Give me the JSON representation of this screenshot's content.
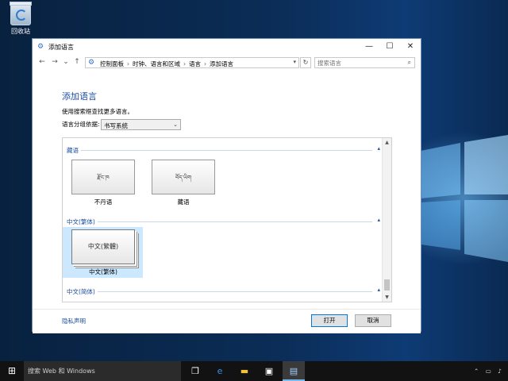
{
  "desktop": {
    "recycle_bin_label": "回收站"
  },
  "window": {
    "title": "添加语言",
    "buttons": {
      "minimize": "—",
      "maximize": "☐",
      "close": "✕"
    }
  },
  "nav": {
    "back": "←",
    "forward": "→",
    "recent": "⌄",
    "up": "↑"
  },
  "address": {
    "crumbs": [
      "控制面板",
      "时钟、语言和区域",
      "语言",
      "添加语言"
    ],
    "separator": "›"
  },
  "search": {
    "placeholder": "搜索语言"
  },
  "content": {
    "heading": "添加语言",
    "description": "使用搜索框查找更多语言。",
    "group_by_label": "语言分组依据:",
    "group_by_value": "书写系统"
  },
  "groups": [
    {
      "header": "藏语",
      "tiles": [
        {
          "sample": "རྫོང་ཁ",
          "name": "不丹语"
        },
        {
          "sample": "བོད་ཡིག",
          "name": "藏语"
        }
      ]
    },
    {
      "header": "中文(繁体)",
      "tiles": [
        {
          "sample": "中文(繁體)",
          "name": "中文(繁体)"
        }
      ]
    },
    {
      "header": "中文(简体)",
      "tiles": []
    }
  ],
  "footer": {
    "privacy": "隐私声明",
    "open_button": "打开",
    "cancel_button": "取消"
  },
  "taskbar": {
    "search_placeholder": "搜索 Web 和 Windows"
  }
}
